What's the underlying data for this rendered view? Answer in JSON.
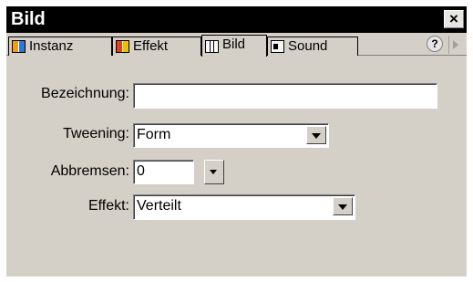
{
  "window": {
    "title": "Bild",
    "close_label": "×"
  },
  "tabs": [
    {
      "label": "Instanz",
      "icon": "instance-icon",
      "active": false
    },
    {
      "label": "Effekt",
      "icon": "effect-icon",
      "active": false
    },
    {
      "label": "Bild",
      "icon": "frame-icon",
      "active": true
    },
    {
      "label": "Sound",
      "icon": "sound-icon",
      "active": false
    }
  ],
  "help_label": "?",
  "form": {
    "bezeichnung_label": "Bezeichnung:",
    "bezeichnung_value": "",
    "tweening_label": "Tweening:",
    "tweening_value": "Form",
    "abbremsen_label": "Abbremsen:",
    "abbremsen_value": "0",
    "effekt_label": "Effekt:",
    "effekt_value": "Verteilt"
  }
}
